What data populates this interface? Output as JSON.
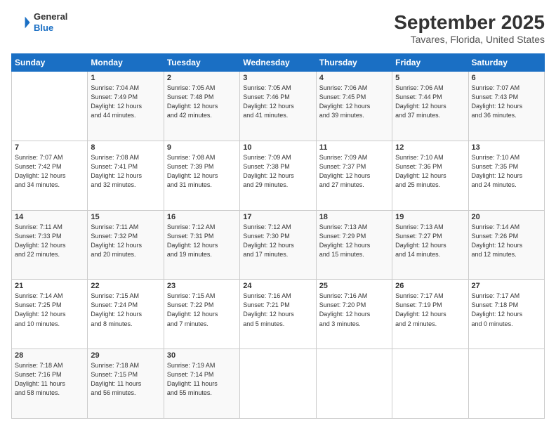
{
  "header": {
    "logo_general": "General",
    "logo_blue": "Blue",
    "title": "September 2025",
    "location": "Tavares, Florida, United States"
  },
  "calendar": {
    "columns": [
      "Sunday",
      "Monday",
      "Tuesday",
      "Wednesday",
      "Thursday",
      "Friday",
      "Saturday"
    ],
    "weeks": [
      [
        {
          "day": "",
          "text": ""
        },
        {
          "day": "1",
          "text": "Sunrise: 7:04 AM\nSunset: 7:49 PM\nDaylight: 12 hours\nand 44 minutes."
        },
        {
          "day": "2",
          "text": "Sunrise: 7:05 AM\nSunset: 7:48 PM\nDaylight: 12 hours\nand 42 minutes."
        },
        {
          "day": "3",
          "text": "Sunrise: 7:05 AM\nSunset: 7:46 PM\nDaylight: 12 hours\nand 41 minutes."
        },
        {
          "day": "4",
          "text": "Sunrise: 7:06 AM\nSunset: 7:45 PM\nDaylight: 12 hours\nand 39 minutes."
        },
        {
          "day": "5",
          "text": "Sunrise: 7:06 AM\nSunset: 7:44 PM\nDaylight: 12 hours\nand 37 minutes."
        },
        {
          "day": "6",
          "text": "Sunrise: 7:07 AM\nSunset: 7:43 PM\nDaylight: 12 hours\nand 36 minutes."
        }
      ],
      [
        {
          "day": "7",
          "text": "Sunrise: 7:07 AM\nSunset: 7:42 PM\nDaylight: 12 hours\nand 34 minutes."
        },
        {
          "day": "8",
          "text": "Sunrise: 7:08 AM\nSunset: 7:41 PM\nDaylight: 12 hours\nand 32 minutes."
        },
        {
          "day": "9",
          "text": "Sunrise: 7:08 AM\nSunset: 7:39 PM\nDaylight: 12 hours\nand 31 minutes."
        },
        {
          "day": "10",
          "text": "Sunrise: 7:09 AM\nSunset: 7:38 PM\nDaylight: 12 hours\nand 29 minutes."
        },
        {
          "day": "11",
          "text": "Sunrise: 7:09 AM\nSunset: 7:37 PM\nDaylight: 12 hours\nand 27 minutes."
        },
        {
          "day": "12",
          "text": "Sunrise: 7:10 AM\nSunset: 7:36 PM\nDaylight: 12 hours\nand 25 minutes."
        },
        {
          "day": "13",
          "text": "Sunrise: 7:10 AM\nSunset: 7:35 PM\nDaylight: 12 hours\nand 24 minutes."
        }
      ],
      [
        {
          "day": "14",
          "text": "Sunrise: 7:11 AM\nSunset: 7:33 PM\nDaylight: 12 hours\nand 22 minutes."
        },
        {
          "day": "15",
          "text": "Sunrise: 7:11 AM\nSunset: 7:32 PM\nDaylight: 12 hours\nand 20 minutes."
        },
        {
          "day": "16",
          "text": "Sunrise: 7:12 AM\nSunset: 7:31 PM\nDaylight: 12 hours\nand 19 minutes."
        },
        {
          "day": "17",
          "text": "Sunrise: 7:12 AM\nSunset: 7:30 PM\nDaylight: 12 hours\nand 17 minutes."
        },
        {
          "day": "18",
          "text": "Sunrise: 7:13 AM\nSunset: 7:29 PM\nDaylight: 12 hours\nand 15 minutes."
        },
        {
          "day": "19",
          "text": "Sunrise: 7:13 AM\nSunset: 7:27 PM\nDaylight: 12 hours\nand 14 minutes."
        },
        {
          "day": "20",
          "text": "Sunrise: 7:14 AM\nSunset: 7:26 PM\nDaylight: 12 hours\nand 12 minutes."
        }
      ],
      [
        {
          "day": "21",
          "text": "Sunrise: 7:14 AM\nSunset: 7:25 PM\nDaylight: 12 hours\nand 10 minutes."
        },
        {
          "day": "22",
          "text": "Sunrise: 7:15 AM\nSunset: 7:24 PM\nDaylight: 12 hours\nand 8 minutes."
        },
        {
          "day": "23",
          "text": "Sunrise: 7:15 AM\nSunset: 7:22 PM\nDaylight: 12 hours\nand 7 minutes."
        },
        {
          "day": "24",
          "text": "Sunrise: 7:16 AM\nSunset: 7:21 PM\nDaylight: 12 hours\nand 5 minutes."
        },
        {
          "day": "25",
          "text": "Sunrise: 7:16 AM\nSunset: 7:20 PM\nDaylight: 12 hours\nand 3 minutes."
        },
        {
          "day": "26",
          "text": "Sunrise: 7:17 AM\nSunset: 7:19 PM\nDaylight: 12 hours\nand 2 minutes."
        },
        {
          "day": "27",
          "text": "Sunrise: 7:17 AM\nSunset: 7:18 PM\nDaylight: 12 hours\nand 0 minutes."
        }
      ],
      [
        {
          "day": "28",
          "text": "Sunrise: 7:18 AM\nSunset: 7:16 PM\nDaylight: 11 hours\nand 58 minutes."
        },
        {
          "day": "29",
          "text": "Sunrise: 7:18 AM\nSunset: 7:15 PM\nDaylight: 11 hours\nand 56 minutes."
        },
        {
          "day": "30",
          "text": "Sunrise: 7:19 AM\nSunset: 7:14 PM\nDaylight: 11 hours\nand 55 minutes."
        },
        {
          "day": "",
          "text": ""
        },
        {
          "day": "",
          "text": ""
        },
        {
          "day": "",
          "text": ""
        },
        {
          "day": "",
          "text": ""
        }
      ]
    ]
  }
}
